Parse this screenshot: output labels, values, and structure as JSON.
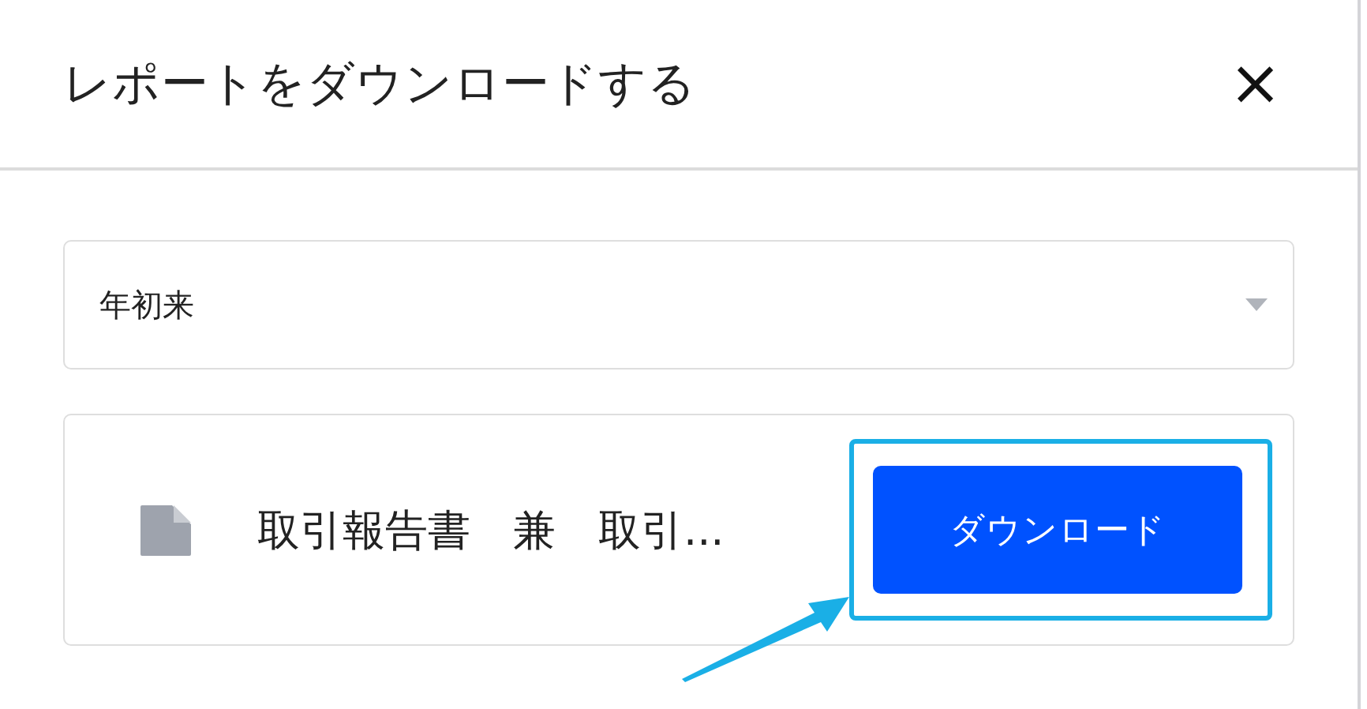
{
  "dialog": {
    "title": "レポートをダウンロードする",
    "close": "×"
  },
  "period_select": {
    "value": "年初来"
  },
  "report": {
    "name": "取引報告書　兼　取引...",
    "button": "ダウンロード"
  }
}
